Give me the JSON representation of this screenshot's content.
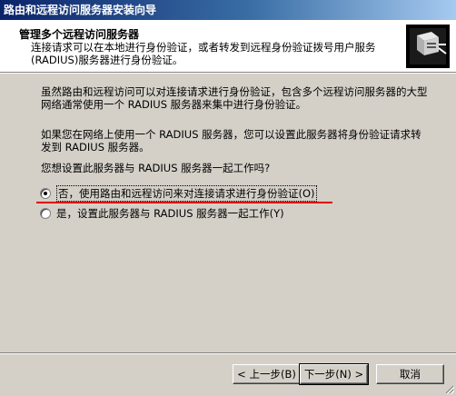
{
  "window": {
    "title": "路由和远程访问服务器安装向导"
  },
  "header": {
    "title": "管理多个远程访问服务器",
    "subtitle": "连接请求可以在本地进行身份验证，或者转发到远程身份验证拨号用户服务(RADIUS)服务器进行身份验证。",
    "icon": "server-network-icon"
  },
  "body": {
    "paragraph1": "虽然路由和远程访问可以对连接请求进行身份验证，包含多个远程访问服务器的大型网络通常使用一个 RADIUS 服务器来集中进行身份验证。",
    "paragraph2": "如果您在网络上使用一个 RADIUS 服务器，您可以设置此服务器将身份验证请求转发到 RADIUS 服务器。",
    "question": "您想设置此服务器与 RADIUS 服务器一起工作吗?"
  },
  "options": {
    "no_label": "否，使用路由和远程访问来对连接请求进行身份验证(O)",
    "no_selected": true,
    "yes_label": "是，设置此服务器与 RADIUS 服务器一起工作(Y)",
    "yes_selected": false
  },
  "buttons": {
    "back": "< 上一步(B)",
    "next": "下一步(N) >",
    "cancel": "取消"
  },
  "colors": {
    "annotation_underline": "#e00000",
    "titlebar_start": "#0a246a",
    "titlebar_end": "#a6caf0"
  }
}
